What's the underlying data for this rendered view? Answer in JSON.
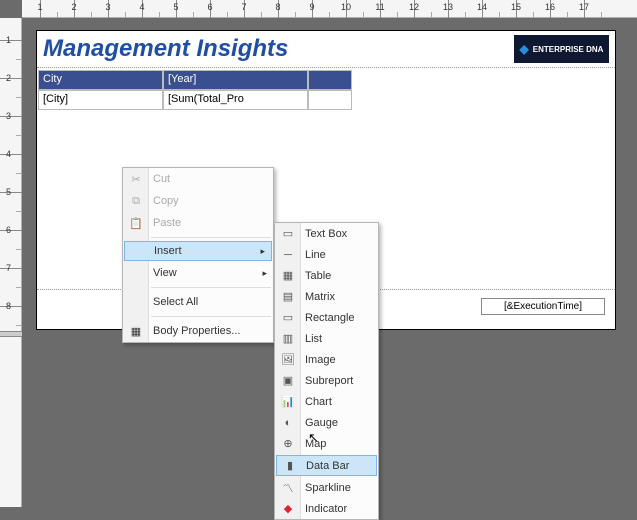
{
  "ruler_h_labels": [
    "1",
    "2",
    "3",
    "4",
    "5",
    "6",
    "7",
    "8",
    "9",
    "10",
    "11",
    "12",
    "13",
    "14",
    "15",
    "16",
    "17"
  ],
  "ruler_v_labels": [
    "1",
    "2",
    "3",
    "4",
    "5",
    "6",
    "7",
    "8"
  ],
  "report": {
    "title": "Management Insights",
    "logo_text": "ENTERPRISE DNA",
    "header_cells": [
      "City",
      "[Year]",
      ""
    ],
    "data_cells": [
      "[City]",
      "[Sum(Total_Pro",
      ""
    ],
    "execution_time": "[&ExecutionTime]"
  },
  "context_menu": [
    {
      "label": "Cut",
      "icon": "✂",
      "disabled": true
    },
    {
      "label": "Copy",
      "icon": "⧉",
      "disabled": true
    },
    {
      "label": "Paste",
      "icon": "📋",
      "disabled": true
    },
    {
      "sep": true
    },
    {
      "label": "Insert",
      "expand": true,
      "highlight": true
    },
    {
      "label": "View",
      "expand": true
    },
    {
      "sep": true
    },
    {
      "label": "Select All"
    },
    {
      "sep": true
    },
    {
      "label": "Body Properties...",
      "icon": "▦"
    }
  ],
  "insert_submenu": [
    {
      "label": "Text Box",
      "icon": "▭"
    },
    {
      "label": "Line",
      "icon": "─"
    },
    {
      "label": "Table",
      "icon": "▦"
    },
    {
      "label": "Matrix",
      "icon": "▤"
    },
    {
      "label": "Rectangle",
      "icon": "▭"
    },
    {
      "label": "List",
      "icon": "▥"
    },
    {
      "label": "Image",
      "icon": "🖼"
    },
    {
      "label": "Subreport",
      "icon": "▣"
    },
    {
      "label": "Chart",
      "icon": "📊"
    },
    {
      "label": "Gauge",
      "icon": "◐"
    },
    {
      "label": "Map",
      "icon": "⊕"
    },
    {
      "label": "Data Bar",
      "icon": "▮",
      "highlight": true
    },
    {
      "label": "Sparkline",
      "icon": "〽"
    },
    {
      "label": "Indicator",
      "icon": "◆"
    }
  ]
}
